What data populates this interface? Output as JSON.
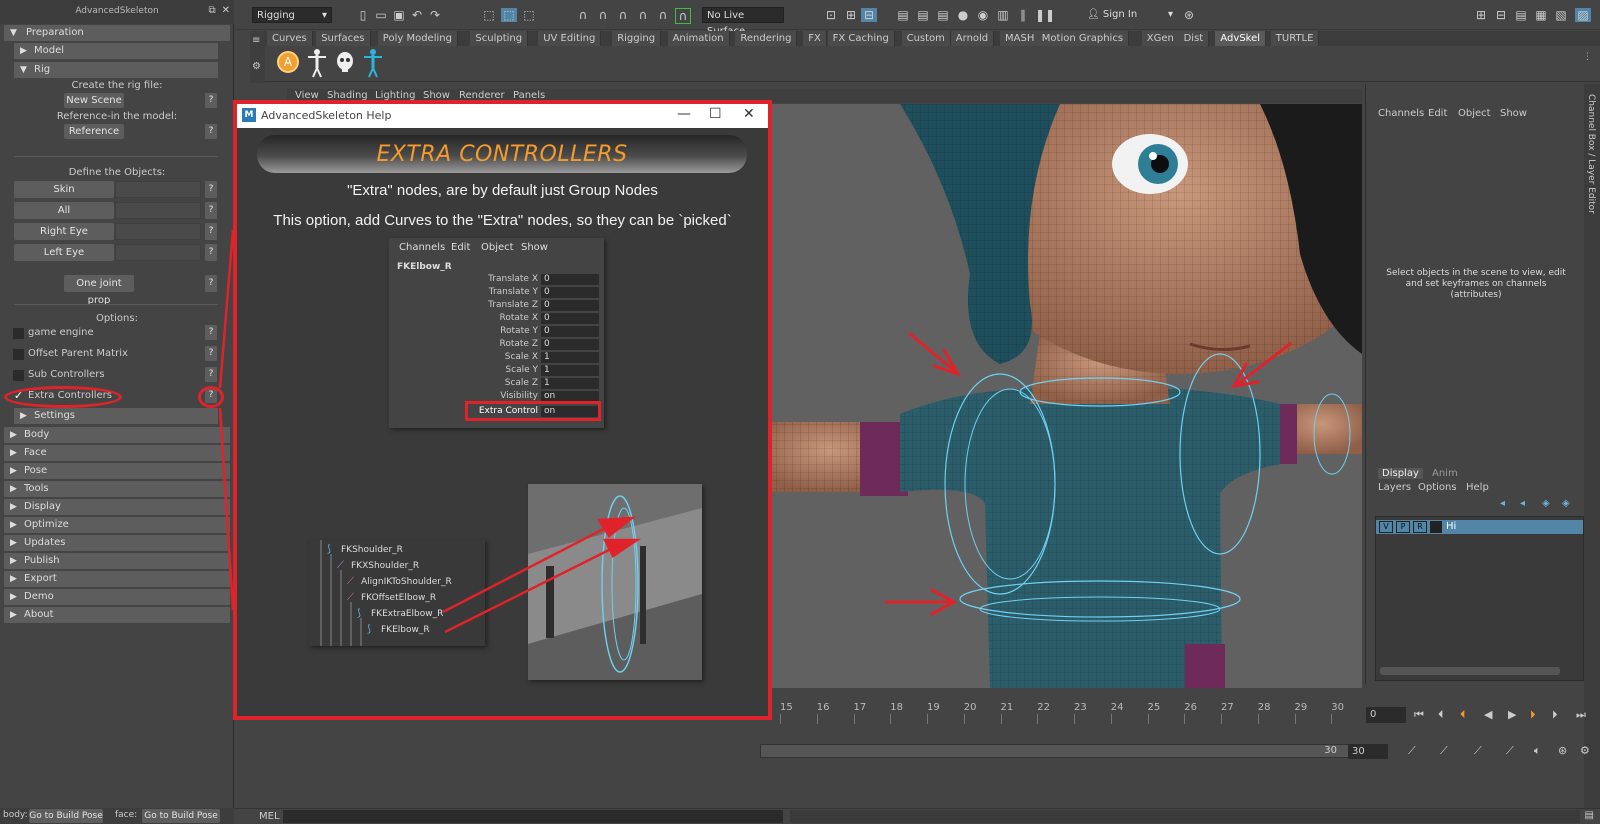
{
  "left_panel": {
    "title": "AdvancedSkeleton",
    "frames": {
      "preparation": "Preparation",
      "model": "Model",
      "rig": "Rig",
      "settings": "Settings",
      "body": "Body",
      "face": "Face",
      "pose": "Pose",
      "tools": "Tools",
      "display": "Display",
      "optimize": "Optimize",
      "updates": "Updates",
      "publish": "Publish",
      "export": "Export",
      "demo": "Demo",
      "about": "About"
    },
    "create_rig_label": "Create the rig file:",
    "new_scene_button": "New Scene",
    "reference_label": "Reference-in the model:",
    "reference_button": "Reference",
    "define_objects_label": "Define the Objects:",
    "objects": [
      "Skin",
      "All",
      "Right Eye",
      "Left Eye"
    ],
    "one_joint_prop_button": "One joint prop",
    "options_label": "Options:",
    "options": [
      {
        "label": "game engine",
        "checked": false
      },
      {
        "label": "Offset Parent Matrix",
        "checked": false
      },
      {
        "label": "Sub Controllers",
        "checked": false
      },
      {
        "label": "Extra Controllers",
        "checked": true
      }
    ],
    "help_button": "?",
    "body_label": "body:",
    "body_build_pose": "Go to Build Pose",
    "face_label": "face:",
    "face_build_pose": "Go to Build Pose"
  },
  "status_line": {
    "menu_set": "Rigging",
    "live_surface": "No Live Surface",
    "sign_in": "Sign In"
  },
  "shelf": {
    "tabs": [
      "Curves",
      "Surfaces",
      "Poly Modeling",
      "Sculpting",
      "UV Editing",
      "Rigging",
      "Animation",
      "Rendering",
      "FX",
      "FX Caching",
      "Custom",
      "Arnold",
      "MASH",
      "Motion Graphics",
      "XGen",
      "Dist",
      "AdvSkel",
      "TURTLE"
    ],
    "active_tab": "AdvSkel",
    "shelf_button_label": "A"
  },
  "viewport": {
    "menu": [
      "View",
      "Shading",
      "Lighting",
      "Show",
      "Renderer",
      "Panels"
    ]
  },
  "channel_box": {
    "menu": [
      "Channels",
      "Edit",
      "Object",
      "Show"
    ],
    "empty_message": "Select objects in the scene to view, edit and set keyframes on channels (attributes)",
    "side_label": "Channel Box / Layer Editor"
  },
  "layer_editor": {
    "tabs": [
      "Display",
      "Anim"
    ],
    "active_tab": "Display",
    "menu": [
      "Layers",
      "Options",
      "Help"
    ],
    "layers": [
      {
        "v": "V",
        "p": "P",
        "r": "R",
        "name": "Hi"
      }
    ]
  },
  "timeline": {
    "ticks": [
      "15",
      "16",
      "17",
      "18",
      "19",
      "20",
      "21",
      "22",
      "23",
      "24",
      "25",
      "26",
      "27",
      "28",
      "29",
      "30"
    ],
    "current_frame": "0",
    "range_end": "30",
    "range_end_field": "30"
  },
  "command_line": {
    "label": "MEL"
  },
  "help_window": {
    "title": "AdvancedSkeleton Help",
    "icon_letter": "M",
    "banner": "EXTRA CONTROLLERS",
    "line1": "\"Extra\" nodes, are by default just Group Nodes",
    "line2": "This option, add Curves to the \"Extra\" nodes, so they can be `picked`",
    "channel_box": {
      "menu": [
        "Channels",
        "Edit",
        "Object",
        "Show"
      ],
      "object": "FKElbow_R",
      "attributes": [
        {
          "name": "Translate X",
          "value": "0"
        },
        {
          "name": "Translate Y",
          "value": "0"
        },
        {
          "name": "Translate Z",
          "value": "0"
        },
        {
          "name": "Rotate X",
          "value": "0"
        },
        {
          "name": "Rotate Y",
          "value": "0"
        },
        {
          "name": "Rotate Z",
          "value": "0"
        },
        {
          "name": "Scale X",
          "value": "1"
        },
        {
          "name": "Scale Y",
          "value": "1"
        },
        {
          "name": "Scale Z",
          "value": "1"
        },
        {
          "name": "Visibility",
          "value": "on"
        },
        {
          "name": "Extra Control",
          "value": "on"
        }
      ]
    },
    "outliner": [
      "FKShoulder_R",
      "FKXShoulder_R",
      "AlignIKToShoulder_R",
      "FKOffsetElbow_R",
      "FKExtraElbow_R",
      "FKElbow_R"
    ]
  },
  "colors": {
    "annotation_red": "#e0232a",
    "banner_orange": "#f59b2c",
    "maya_bg": "#444444",
    "selection_blue": "#5285a6"
  }
}
